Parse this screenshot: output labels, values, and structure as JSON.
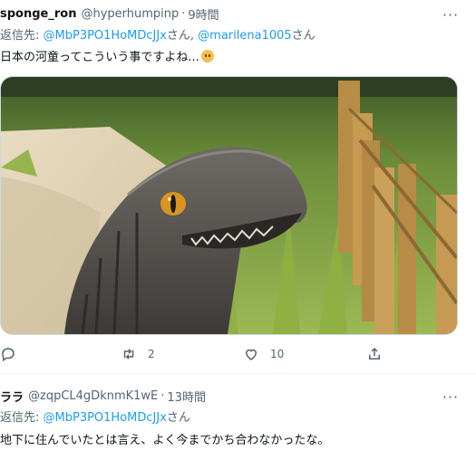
{
  "tweet1": {
    "display_name": "sponge_ron",
    "handle": "@hyperhumpinp",
    "separator": "·",
    "time": "9時間",
    "more": "···",
    "reply_prefix": "返信先: ",
    "reply_user1": "@MbP3PO1HoMDcJJx",
    "reply_mid": "さん, ",
    "reply_user2": "@marilena1005",
    "reply_suffix": "さん",
    "text": "日本の河童ってこういう事ですよね...",
    "emoji": "worried-face-emoji",
    "actions": {
      "reply_count": "",
      "retweet_count": "2",
      "like_count": "10"
    }
  },
  "tweet2": {
    "display_name": "ララ",
    "handle": "@zqpCL4gDknmK1wE",
    "separator": "·",
    "time": "13時間",
    "more": "···",
    "reply_prefix": "返信先: ",
    "reply_user1": "@MbP3PO1HoMDcJJx",
    "reply_suffix": "さん",
    "text": "地下に住んでいたとは言え、よく今までかち合わなかったな。"
  },
  "colors": {
    "link": "#1d9bf0",
    "muted": "#536471",
    "text": "#0f1419",
    "border": "#cfd9de"
  }
}
